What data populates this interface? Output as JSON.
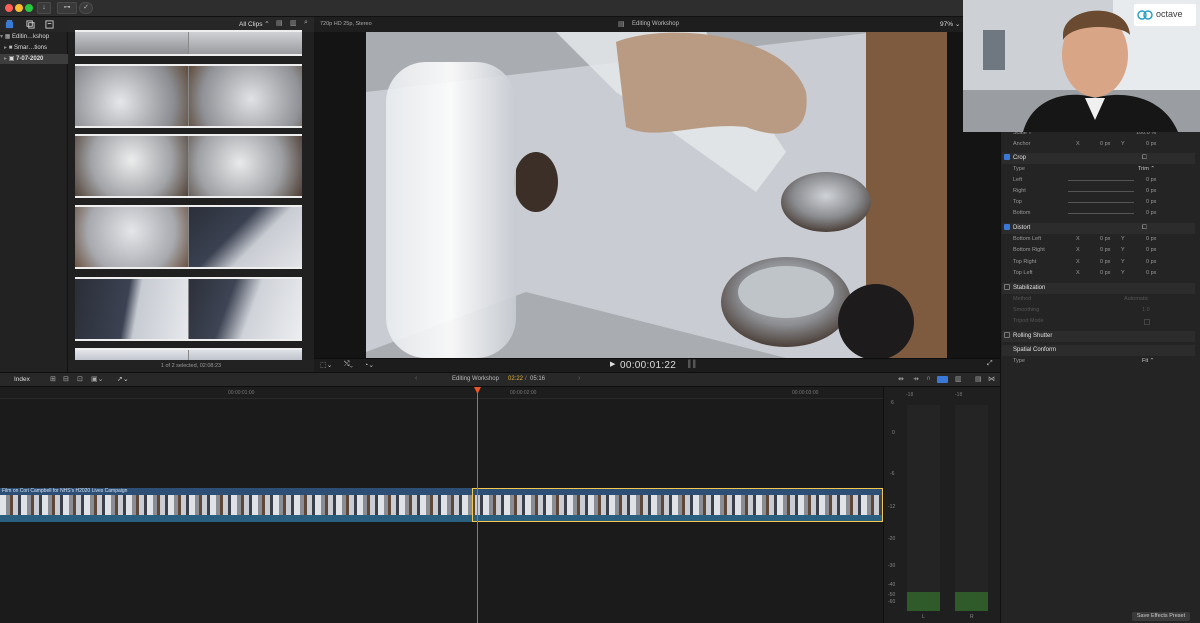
{
  "titlebar": {
    "traffic_colors": [
      "#ff5f57",
      "#febc2e",
      "#28c840"
    ],
    "buttons": [
      "↓",
      "⊶",
      "✓"
    ]
  },
  "library": {
    "items": [
      {
        "label": "Editin…kshop",
        "icon": "library-icon"
      },
      {
        "label": "Smar…tions",
        "icon": "folder-icon"
      },
      {
        "label": "7-07-2020",
        "icon": "event-icon",
        "selected": true
      }
    ]
  },
  "browser": {
    "filter_label": "All Clips",
    "status": "1 of 2 selected, 02:08:23"
  },
  "viewer": {
    "format": "720p HD 25p, Stereo",
    "project_title": "Editing Workshop",
    "zoom": "97%",
    "timecode": "00:00:01:22"
  },
  "timeline": {
    "index_label": "Index",
    "project_title": "Editing Workshop",
    "position": "02:22",
    "duration": "05:16",
    "ruler_ticks": [
      "00:00:01:00",
      "00:00:02:00",
      "00:00:03:00"
    ],
    "clip_label": "Film on Cori Campbell for NHS's H2020 Lives Campaign",
    "meter_scale": [
      "6",
      "0",
      "-6",
      "-12",
      "-20",
      "-30",
      "-40",
      "-50",
      "-60"
    ],
    "meter_channels": [
      "L",
      "R"
    ],
    "meter_peaks": [
      "-18",
      "-18"
    ]
  },
  "inspector": {
    "rows": [
      {
        "type": "field",
        "label": "Scale Y",
        "value": "100.0 %"
      },
      {
        "type": "field",
        "label": "Anchor",
        "x": "0 px",
        "y": "0 px"
      },
      {
        "type": "section",
        "label": "Crop",
        "checked": true
      },
      {
        "type": "field",
        "label": "Type",
        "value": "Trim"
      },
      {
        "type": "field",
        "label": "Left",
        "value": "0 px"
      },
      {
        "type": "field",
        "label": "Right",
        "value": "0 px"
      },
      {
        "type": "field",
        "label": "Top",
        "value": "0 px"
      },
      {
        "type": "field",
        "label": "Bottom",
        "value": "0 px"
      },
      {
        "type": "section",
        "label": "Distort",
        "checked": true
      },
      {
        "type": "field",
        "label": "Bottom Left",
        "x": "0 px",
        "y": "0 px"
      },
      {
        "type": "field",
        "label": "Bottom Right",
        "x": "0 px",
        "y": "0 px"
      },
      {
        "type": "field",
        "label": "Top Right",
        "x": "0 px",
        "y": "0 px"
      },
      {
        "type": "field",
        "label": "Top Left",
        "x": "0 px",
        "y": "0 px"
      },
      {
        "type": "section",
        "label": "Stabilization",
        "checked": false
      },
      {
        "type": "field",
        "label": "Method",
        "value": "Automatic",
        "dim": true
      },
      {
        "type": "field",
        "label": "Smoothing",
        "value": "1.0",
        "dim": true
      },
      {
        "type": "field",
        "label": "Tripod Mode",
        "value": "",
        "dim": true
      },
      {
        "type": "section",
        "label": "Rolling Shutter",
        "checked": false
      },
      {
        "type": "section",
        "label": "Spatial Conform",
        "checked": null
      },
      {
        "type": "field",
        "label": "Type",
        "value": "Fit"
      }
    ],
    "x_label": "X",
    "y_label": "Y",
    "preset_button": "Save Effects Preset"
  },
  "webcam": {
    "brand": "octave"
  },
  "colors": {
    "playhead": "#e8562a",
    "clip_blue": "#2f5b8a",
    "selection": "#f2c94c",
    "meter_green": "#2f5a2a",
    "timecode_yellow": "#e3b53c"
  }
}
